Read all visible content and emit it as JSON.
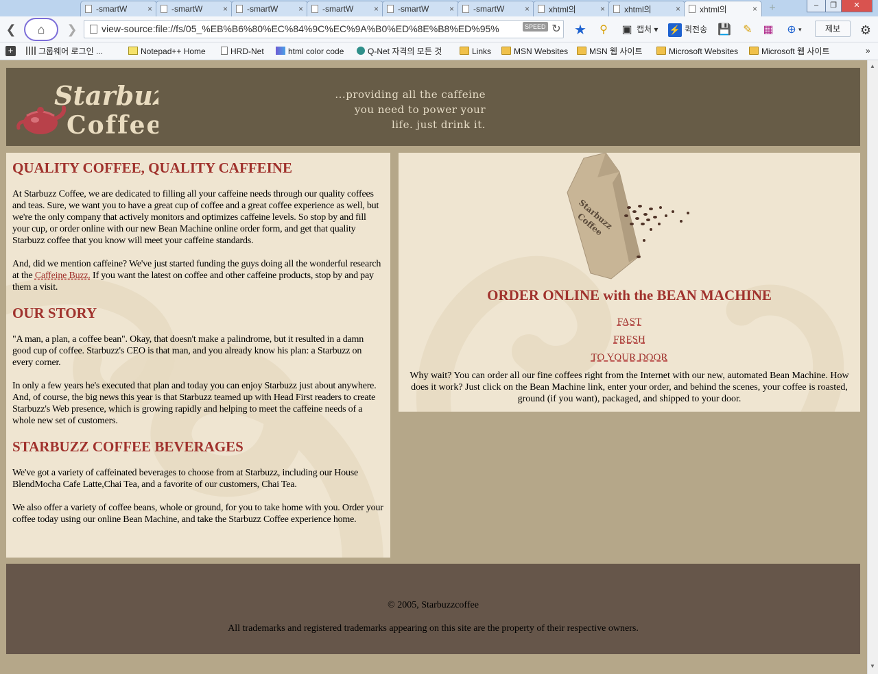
{
  "browser": {
    "tabs": [
      {
        "title": "-smartW"
      },
      {
        "title": "-smartW"
      },
      {
        "title": "-smartW"
      },
      {
        "title": "-smartW"
      },
      {
        "title": "-smartW"
      },
      {
        "title": "-smartW"
      },
      {
        "title": "xhtml의"
      },
      {
        "title": "xhtml의"
      },
      {
        "title": "xhtml의"
      }
    ],
    "active_tab_index": 8,
    "tab_close_glyph": "×",
    "new_tab_glyph": "+",
    "address": "view-source:file://fs/05_%EB%B6%80%EC%84%9C%EC%9A%B0%ED%8E%B8%ED%95%",
    "speed_badge": "SPEED",
    "toolbar": {
      "capture_label": "캡처",
      "quick_send_label": "퀵전송",
      "report_label": "제보"
    },
    "bookmarks": [
      {
        "label": "그룹웨어 로그인 ...",
        "icon": "grid-page-icon"
      },
      {
        "label": "Notepad++ Home",
        "icon": "notepad-icon"
      },
      {
        "label": "HRD-Net",
        "icon": "page-icon"
      },
      {
        "label": "html color code",
        "icon": "color-grid-icon"
      },
      {
        "label": "Q-Net 자격의 모든 것",
        "icon": "qnet-icon"
      },
      {
        "label": "Links",
        "icon": "folder-icon"
      },
      {
        "label": "MSN Websites",
        "icon": "folder-icon"
      },
      {
        "label": "MSN 웹 사이트",
        "icon": "folder-icon"
      },
      {
        "label": "Microsoft Websites",
        "icon": "folder-icon"
      },
      {
        "label": "Microsoft 웹 사이트",
        "icon": "folder-icon"
      }
    ],
    "bookmarks_more": "»"
  },
  "page": {
    "colors": {
      "background": "#b5a789",
      "header": "#675c47",
      "panel": "#efe5d1",
      "heading": "#a0322d",
      "footer": "#66564a"
    },
    "header": {
      "logo_text_top": "Starbuzz",
      "logo_text_bottom": "Coffee",
      "tagline": [
        "...providing all the caffeine",
        "you need to power your",
        "life. just drink it."
      ]
    },
    "main": {
      "sections": [
        {
          "heading": "QUALITY COFFEE, QUALITY CAFFEINE",
          "paragraphs": [
            "At Starbuzz Coffee, we are dedicated to filling all your caffeine needs through our quality coffees and teas. Sure, we want you to have a great cup of coffee and a great coffee experience as well, but we're the only company that actively monitors and optimizes caffeine levels. So stop by and fill your cup, or order online with our new Bean Machine online order form, and get that quality Starbuzz coffee that you know will meet your caffeine standards."
          ],
          "p2_before": "And, did we mention caffeine? We've just started funding the guys doing all the wonderful research at the ",
          "p2_link": "Caffeine Buzz.",
          "p2_after": " If you want the latest on coffee and other caffeine products, stop by and pay them a visit."
        },
        {
          "heading": "OUR STORY",
          "paragraphs": [
            "\"A man, a plan, a coffee bean\". Okay, that doesn't make a palindrome, but it resulted in a damn good cup of coffee. Starbuzz's CEO is that man, and you already know his plan: a Starbuzz on every corner.",
            "In only a few years he's executed that plan and today you can enjoy Starbuzz just about anywhere. And, of course, the big news this year is that Starbuzz teamed up with Head First readers to create Starbuzz's Web presence, which is growing rapidly and helping to meet the caffeine needs of a whole new set of customers."
          ]
        },
        {
          "heading": "STARBUZZ COFFEE BEVERAGES",
          "paragraphs": [
            "We've got a variety of caffeinated beverages to choose from at Starbuzz, including our House BlendMocha Cafe Latte,Chai Tea, and a favorite of our customers, Chai Tea.",
            "We also offer a variety of coffee beans, whole or ground, for you to take home with you. Order your coffee today using our online Bean Machine, and take the Starbuzz Coffee experience home."
          ]
        }
      ]
    },
    "sidebar": {
      "bag_text_1": "Starbuzz",
      "bag_text_2": "Coffee",
      "title": "ORDER ONLINE with the BEAN MACHINE",
      "links": [
        "FAST",
        "FRESH",
        "TO YOUR DOOR"
      ],
      "description": "Why wait? You can order all our fine coffees right from the Internet with our new, automated Bean Machine. How does it work? Just click on the Bean Machine link, enter your order, and behind the scenes, your coffee is roasted, ground (if you want), packaged, and shipped to your door."
    },
    "footer": {
      "copyright": "© 2005, Starbuzzcoffee",
      "trademark": "All trademarks and registered trademarks appearing on this site are the property of their respective owners."
    }
  }
}
